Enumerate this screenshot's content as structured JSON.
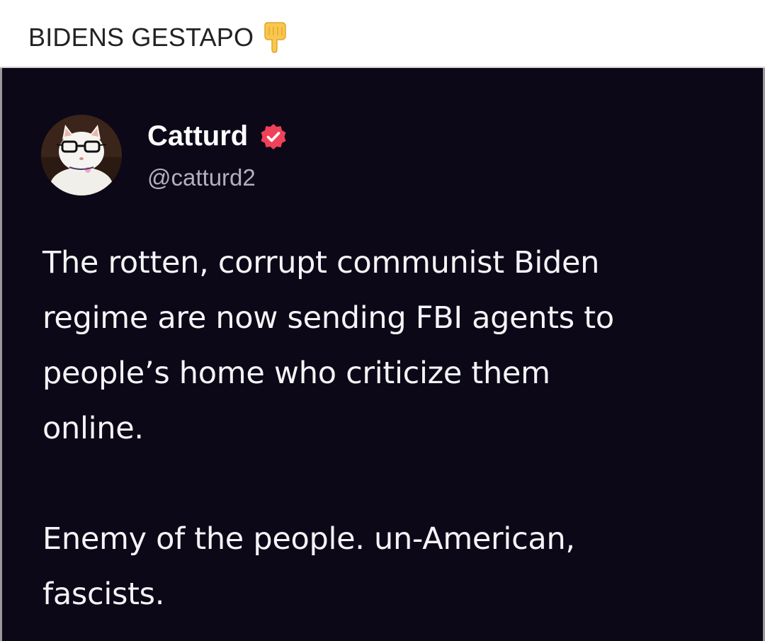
{
  "post": {
    "title": "BIDENS GESTAPO",
    "title_icon": "backhand-pointing-down-icon"
  },
  "tweet": {
    "display_name": "Catturd",
    "handle": "@catturd2",
    "verified_icon": "verified-badge-icon",
    "avatar_icon": "cat-with-glasses-avatar",
    "paragraphs": [
      "The rotten, corrupt communist Biden\nregime are now sending FBI agents to\npeople’s home who criticize them\nonline.",
      "Enemy of the people. un-American,\nfascists."
    ],
    "colors": {
      "background": "#0c0818",
      "text": "#f4f4f6",
      "handle": "#b3b0bc",
      "verified": "#f0415a"
    }
  }
}
